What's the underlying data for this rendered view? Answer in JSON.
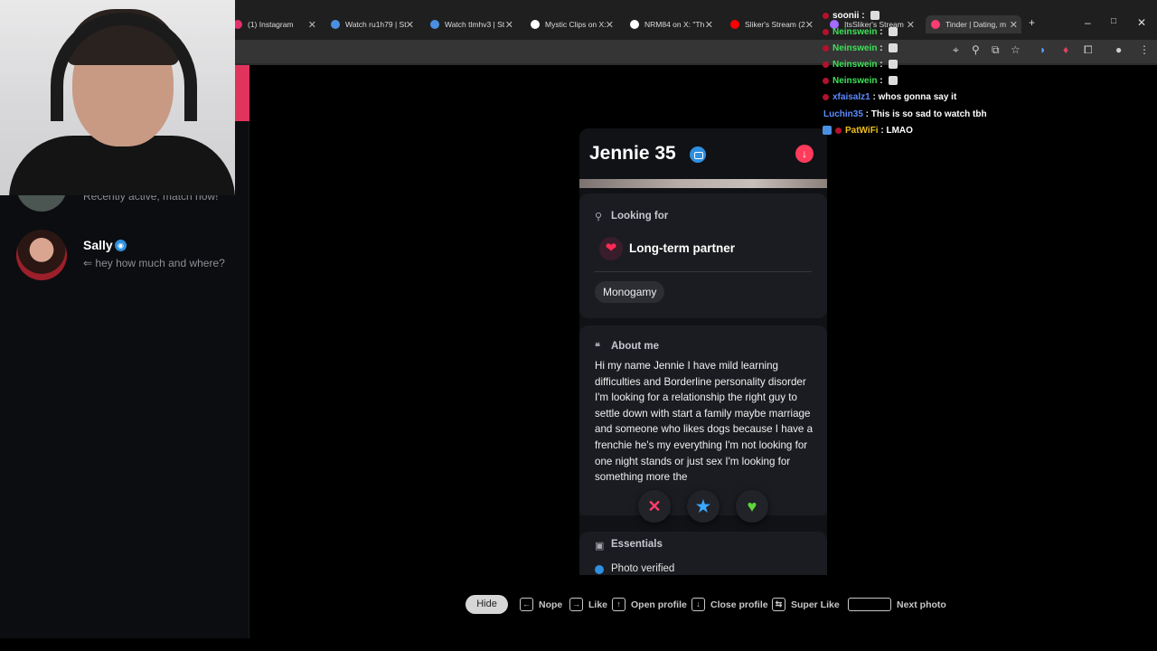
{
  "browser": {
    "tabs": [
      {
        "label": "(1) Instagram",
        "favicon_color": "#e1306c"
      },
      {
        "label": "Watch ru1h79 | St",
        "favicon_color": "#4a90e2"
      },
      {
        "label": "Watch tlmhv3 | St",
        "favicon_color": "#4a90e2"
      },
      {
        "label": "Mystic Clips on X:",
        "favicon_color": "#ffffff"
      },
      {
        "label": "NRM84 on X: \"Th",
        "favicon_color": "#ffffff"
      },
      {
        "label": "Sliker's Stream (2",
        "favicon_color": "#ff0000"
      },
      {
        "label": "ItsSliker's Stream",
        "favicon_color": "#a16cff"
      },
      {
        "label": "Tinder | Dating, m",
        "favicon_color": "#fe3c72"
      }
    ],
    "new_tab_glyph": "+",
    "window_controls": [
      "–",
      "□",
      "✕"
    ]
  },
  "sidebar": {
    "previous_match_status": "Recently active, match now!",
    "matches": [
      {
        "name": "Sally",
        "verified": true,
        "last_message": "⇐ hey how much and where?"
      }
    ]
  },
  "profile": {
    "name_age": "Jennie 35",
    "verified": true,
    "looking_for_heading": "Looking for",
    "looking_for_value": "Long-term partner",
    "looking_for_emoji": "❤",
    "relationship_type": "Monogamy",
    "about_heading": "About me",
    "about_text": "Hi my name Jennie I have mild learning difficulties and Borderline personality disorder I'm looking for a relationship the right guy to settle down with start a family maybe marriage and someone who likes dogs because I have a frenchie he's my everything I'm not looking for one night stands or just sex I'm looking for something more the",
    "essentials_heading": "Essentials",
    "photo_verified_label": "Photo verified"
  },
  "actions": {
    "nope_glyph": "✕",
    "super_like_glyph": "★",
    "like_glyph": "♥"
  },
  "shortcuts": {
    "hide_label": "Hide",
    "items": [
      {
        "key": "←",
        "label": "Nope"
      },
      {
        "key": "→",
        "label": "Like"
      },
      {
        "key": "↑",
        "label": "Open profile"
      },
      {
        "key": "↓",
        "label": "Close profile"
      },
      {
        "key": "⇆",
        "label": "Super Like"
      },
      {
        "key": "",
        "label": "Next photo"
      }
    ]
  },
  "chat": [
    {
      "user": "soonii",
      "color": "#ffffff",
      "message": ""
    },
    {
      "user": "Neinswein",
      "color": "#3fe05a",
      "message": ""
    },
    {
      "user": "Neinswein",
      "color": "#3fe05a",
      "message": ""
    },
    {
      "user": "Neinswein",
      "color": "#3fe05a",
      "message": ""
    },
    {
      "user": "Neinswein",
      "color": "#3fe05a",
      "message": ""
    },
    {
      "user": "xfaisalz1",
      "color": "#5b8cff",
      "message": "whos gonna say it"
    },
    {
      "user": "Luchin35",
      "color": "#5b8cff",
      "message": "This is so sad to watch tbh"
    },
    {
      "user": "PatWiFi",
      "color": "#f0c020",
      "message": "LMAO"
    }
  ],
  "colors": {
    "accent": "#fe3c72",
    "verified_blue": "#2f8fe0",
    "card_bg": "#1b1c21"
  }
}
